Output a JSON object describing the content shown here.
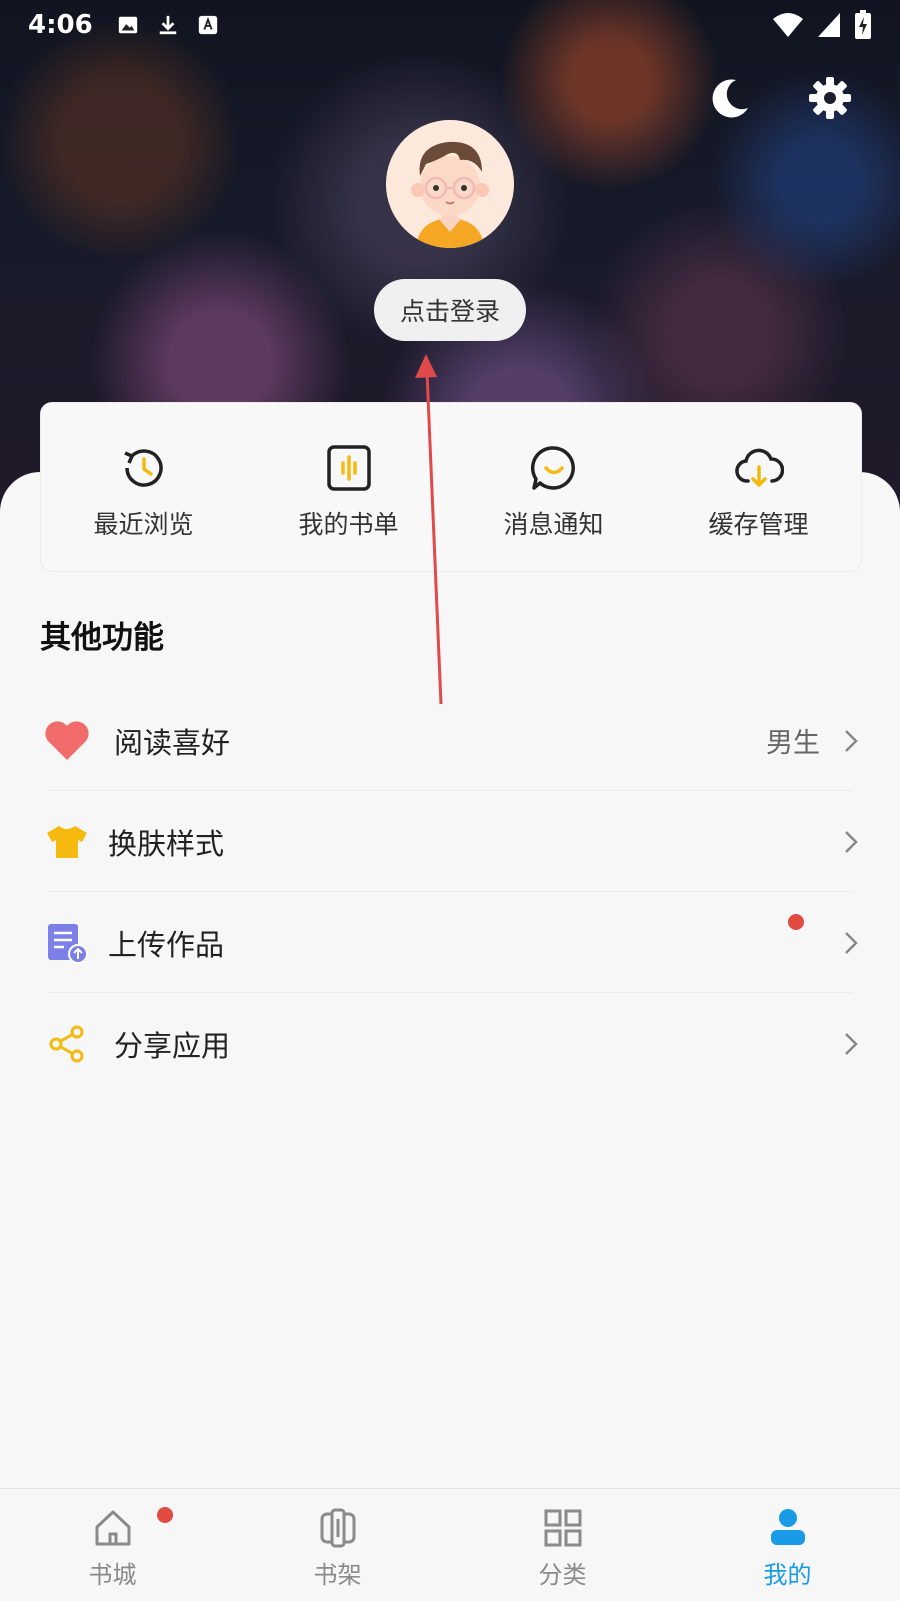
{
  "status_bar": {
    "time": "4:06",
    "left_icons": [
      "image-icon",
      "download-icon",
      "translate-icon"
    ],
    "right_icons": [
      "wifi-icon",
      "signal-icon",
      "battery-charging-icon"
    ]
  },
  "header": {
    "night_mode_icon": "moon-icon",
    "settings_icon": "gear-icon",
    "avatar": "avatar-cartoon-boy",
    "login_label": "点击登录"
  },
  "quick_actions": [
    {
      "label": "最近浏览",
      "icon": "history-icon"
    },
    {
      "label": "我的书单",
      "icon": "booklist-icon"
    },
    {
      "label": "消息通知",
      "icon": "message-icon"
    },
    {
      "label": "缓存管理",
      "icon": "cloud-download-icon"
    }
  ],
  "other_features": {
    "title": "其他功能",
    "items": [
      {
        "label": "阅读喜好",
        "value": "男生",
        "icon": "heart-icon"
      },
      {
        "label": "换肤样式",
        "value": "",
        "icon": "tshirt-icon"
      },
      {
        "label": "上传作品",
        "value": "",
        "icon": "upload-doc-icon",
        "badge": true
      },
      {
        "label": "分享应用",
        "value": "",
        "icon": "share-icon"
      }
    ]
  },
  "bottom_nav": [
    {
      "label": "书城",
      "icon": "home-icon",
      "badge": true,
      "active": false
    },
    {
      "label": "书架",
      "icon": "bookshelf-icon",
      "badge": false,
      "active": false
    },
    {
      "label": "分类",
      "icon": "category-icon",
      "badge": false,
      "active": false
    },
    {
      "label": "我的",
      "icon": "profile-icon",
      "badge": false,
      "active": true
    }
  ],
  "colors": {
    "accent": "#1a9be8",
    "badge": "#e24b41",
    "icon_yellow": "#f5b90f",
    "heart": "#f26b6b",
    "upload_purple": "#7b7fe6",
    "annotation_arrow": "#e04a4a"
  }
}
